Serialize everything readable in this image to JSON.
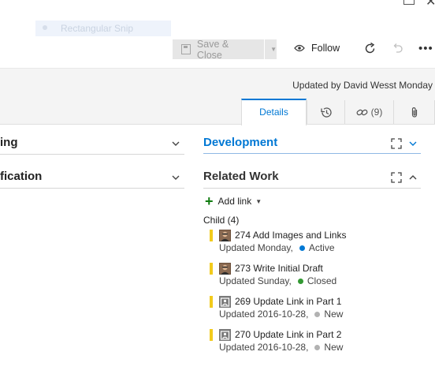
{
  "snip_tool": {
    "label": "Rectangular Snip"
  },
  "toolbar": {
    "save_close_label": "Save & Close",
    "follow_label": "Follow",
    "more_label": "•••"
  },
  "header": {
    "updated_text": "Updated by David Wesst Monday"
  },
  "tabs": [
    {
      "label": "Details",
      "active": true
    },
    {
      "label": "history-icon"
    },
    {
      "label": "(9)",
      "icon": "link-icon"
    },
    {
      "label": "attachment-icon"
    }
  ],
  "left_sections": [
    {
      "title": "ing"
    },
    {
      "title": "fication"
    }
  ],
  "development": {
    "title": "Development"
  },
  "related_work": {
    "title": "Related Work",
    "add_link_label": "Add link",
    "child_header": "Child (4)",
    "items": [
      {
        "id": "274",
        "title": "Add Images and Links",
        "updated": "Updated Monday,",
        "state": "Active",
        "state_color": "#0078d4",
        "avatar": "photo"
      },
      {
        "id": "273",
        "title": "Write Initial Draft",
        "updated": "Updated Sunday,",
        "state": "Closed",
        "state_color": "#339933",
        "avatar": "photo"
      },
      {
        "id": "269",
        "title": "Update Link in Part 1",
        "updated": "Updated 2016-10-28,",
        "state": "New",
        "state_color": "#b2b2b2",
        "avatar": "placeholder"
      },
      {
        "id": "270",
        "title": "Update Link in Part 2",
        "updated": "Updated 2016-10-28,",
        "state": "New",
        "state_color": "#b2b2b2",
        "avatar": "placeholder"
      }
    ]
  },
  "colors": {
    "accent": "#0078d4",
    "work_item_bar": "#f2cb1d",
    "add_green": "#107c10"
  }
}
